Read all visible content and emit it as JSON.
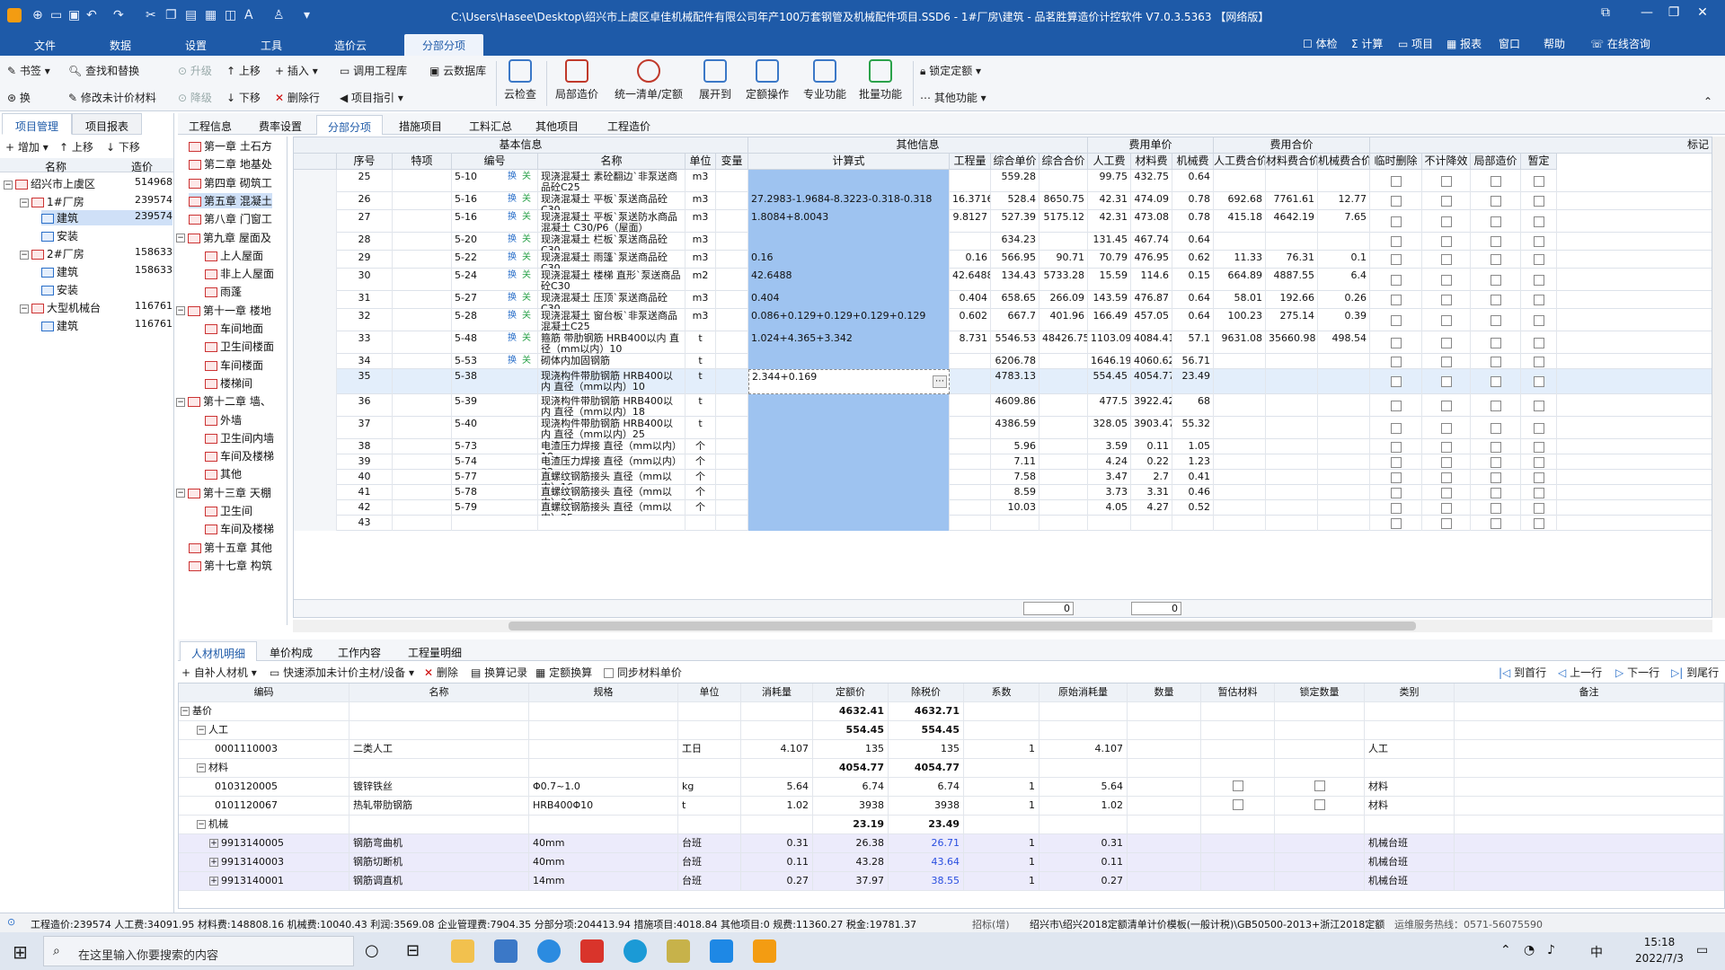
{
  "app": {
    "title": "C:\\Users\\Hasee\\Desktop\\绍兴市上虞区卓佳机械配件有限公司年产100万套钢管及机械配件项目.SSD6 - 1#厂房\\建筑 - 品茗胜算造价计控软件",
    "version": "V7.0.3.5363",
    "network": "【网络版】"
  },
  "menu": {
    "items": [
      "文件",
      "数据",
      "设置",
      "工具",
      "造价云",
      "分部分项"
    ],
    "active": "分部分项",
    "right": [
      "体检",
      "计算",
      "项目",
      "报表",
      "窗口",
      "帮助",
      "在线咨询"
    ]
  },
  "ribbon": {
    "small": [
      "书签",
      "查找和替换",
      "升级",
      "上移",
      "插入",
      "调用工程库",
      "云数据库",
      "换",
      "修改未计价材料",
      "降级",
      "下移",
      "删除行",
      "项目指引",
      "锁定定额",
      "其他功能"
    ],
    "big": [
      "云检查",
      "局部造价",
      "统一清单/定额",
      "展开到",
      "定额操作",
      "专业功能",
      "批量功能"
    ]
  },
  "left": {
    "tabs": [
      "项目管理",
      "项目报表"
    ],
    "toolbar": [
      "增加",
      "上移",
      "下移"
    ],
    "headers": [
      "名称",
      "造价"
    ],
    "tree": [
      {
        "label": "绍兴市上虞区",
        "value": "514968"
      },
      {
        "label": "1#厂房",
        "value": "239574"
      },
      {
        "label": "建筑",
        "value": "239574"
      },
      {
        "label": "安装",
        "value": ""
      },
      {
        "label": "2#厂房",
        "value": "158633"
      },
      {
        "label": "建筑",
        "value": "158633"
      },
      {
        "label": "安装",
        "value": ""
      },
      {
        "label": "大型机械台",
        "value": "116761"
      },
      {
        "label": "建筑",
        "value": "116761"
      }
    ]
  },
  "chapters": [
    "第一章 土石方",
    "第二章 地基处",
    "第四章 砌筑工",
    "第五章 混凝土",
    "第八章 门窗工",
    "第九章 屋面及",
    "上人屋面",
    "非上人屋面",
    "雨蓬",
    "第十一章 楼地",
    "车间地面",
    "卫生间楼面",
    "车间楼面",
    "楼梯间",
    "第十二章 墙、",
    "外墙",
    "卫生间内墙",
    "车间及楼梯",
    "其他",
    "第十三章 天棚",
    "卫生间",
    "车间及楼梯",
    "第十五章 其他",
    "第十七章 构筑"
  ],
  "maintabs": [
    "工程信息",
    "费率设置",
    "分部分项",
    "措施项目",
    "工料汇总",
    "其他项目",
    "工程造价"
  ],
  "grid": {
    "groups": [
      "基本信息",
      "其他信息",
      "费用单价",
      "费用合价",
      "标记"
    ],
    "headers": [
      "序号",
      "特项",
      "编号",
      "名称",
      "单位",
      "变量",
      "计算式",
      "工程量",
      "综合单价",
      "综合合价",
      "人工费",
      "材料费",
      "机械费",
      "人工费合价",
      "材料费合价",
      "机械费合价",
      "临时删除",
      "不计降效",
      "局部造价",
      "暂定"
    ],
    "rows": [
      [
        "25",
        "",
        "5-10",
        "现浇混凝土 素砼翻边`非泵送商品砼C25",
        "m3",
        "",
        "",
        "",
        "559.28",
        "",
        "99.75",
        "432.75",
        "0.64",
        "",
        "",
        ""
      ],
      [
        "26",
        "",
        "5-16",
        "现浇混凝土 平板`泵送商品砼C30",
        "m3",
        "",
        "27.2983-1.9684-8.3223-0.318-0.318",
        "16.3716",
        "528.4",
        "8650.75",
        "42.31",
        "474.09",
        "0.78",
        "692.68",
        "7761.61",
        "12.77"
      ],
      [
        "27",
        "",
        "5-16",
        "现浇混凝土 平板`泵送防水商品混凝土 C30/P6（屋面）",
        "m3",
        "",
        "1.8084+8.0043",
        "9.8127",
        "527.39",
        "5175.12",
        "42.31",
        "473.08",
        "0.78",
        "415.18",
        "4642.19",
        "7.65"
      ],
      [
        "28",
        "",
        "5-20",
        "现浇混凝土 栏板`泵送商品砼C30",
        "m3",
        "",
        "",
        "",
        "634.23",
        "",
        "131.45",
        "467.74",
        "0.64",
        "",
        "",
        ""
      ],
      [
        "29",
        "",
        "5-22",
        "现浇混凝土 雨篷`泵送商品砼C30",
        "m3",
        "",
        "0.16",
        "0.16",
        "566.95",
        "90.71",
        "70.79",
        "476.95",
        "0.62",
        "11.33",
        "76.31",
        "0.1"
      ],
      [
        "30",
        "",
        "5-24",
        "现浇混凝土 楼梯 直形`泵送商品砼C30",
        "m2",
        "",
        "42.6488",
        "42.6488",
        "134.43",
        "5733.28",
        "15.59",
        "114.6",
        "0.15",
        "664.89",
        "4887.55",
        "6.4"
      ],
      [
        "31",
        "",
        "5-27",
        "现浇混凝土 压顶`泵送商品砼C30",
        "m3",
        "",
        "0.404",
        "0.404",
        "658.65",
        "266.09",
        "143.59",
        "476.87",
        "0.64",
        "58.01",
        "192.66",
        "0.26"
      ],
      [
        "32",
        "",
        "5-28",
        "现浇混凝土 窗台板`非泵送商品混凝土C25",
        "m3",
        "",
        "0.086+0.129+0.129+0.129+0.129",
        "0.602",
        "667.7",
        "401.96",
        "166.49",
        "457.05",
        "0.64",
        "100.23",
        "275.14",
        "0.39"
      ],
      [
        "33",
        "",
        "5-48",
        "箍筋 带肋钢筋 HRB400以内 直径（mm以内）10",
        "t",
        "",
        "1.024+4.365+3.342",
        "8.731",
        "5546.53",
        "48426.75",
        "1103.09",
        "4084.41",
        "57.1",
        "9631.08",
        "35660.98",
        "498.54"
      ],
      [
        "34",
        "",
        "5-53",
        "砌体内加固钢筋",
        "t",
        "",
        "",
        "",
        "6206.78",
        "",
        "1646.19",
        "4060.62",
        "56.71",
        "",
        "",
        ""
      ],
      [
        "35",
        "",
        "5-38",
        "现浇构件带肋钢筋 HRB400以内 直径（mm以内）10",
        "t",
        "",
        "2.344+0.169",
        "",
        "4783.13",
        "",
        "554.45",
        "4054.77",
        "23.49",
        "",
        "",
        ""
      ],
      [
        "36",
        "",
        "5-39",
        "现浇构件带肋钢筋 HRB400以内 直径（mm以内）18",
        "t",
        "",
        "",
        "",
        "4609.86",
        "",
        "477.5",
        "3922.42",
        "68",
        "",
        "",
        ""
      ],
      [
        "37",
        "",
        "5-40",
        "现浇构件带肋钢筋 HRB400以内 直径（mm以内）25",
        "t",
        "",
        "",
        "",
        "4386.59",
        "",
        "328.05",
        "3903.47",
        "55.32",
        "",
        "",
        ""
      ],
      [
        "38",
        "",
        "5-73",
        "电渣压力焊接 直径（mm以内）18",
        "个",
        "",
        "",
        "",
        "5.96",
        "",
        "3.59",
        "0.11",
        "1.05",
        "",
        "",
        ""
      ],
      [
        "39",
        "",
        "5-74",
        "电渣压力焊接 直径（mm以内）32",
        "个",
        "",
        "",
        "",
        "7.11",
        "",
        "4.24",
        "0.22",
        "1.23",
        "",
        "",
        ""
      ],
      [
        "40",
        "",
        "5-77",
        "直螺纹钢筋接头 直径（mm以内）16",
        "个",
        "",
        "",
        "",
        "7.58",
        "",
        "3.47",
        "2.7",
        "0.41",
        "",
        "",
        ""
      ],
      [
        "41",
        "",
        "5-78",
        "直螺纹钢筋接头 直径（mm以内）20",
        "个",
        "",
        "",
        "",
        "8.59",
        "",
        "3.73",
        "3.31",
        "0.46",
        "",
        "",
        ""
      ],
      [
        "42",
        "",
        "5-79",
        "直螺纹钢筋接头 直径（mm以内）25",
        "个",
        "",
        "",
        "",
        "10.03",
        "",
        "4.05",
        "4.27",
        "0.52",
        "",
        "",
        ""
      ],
      [
        "43",
        "",
        "",
        "",
        "",
        "",
        "",
        "",
        "",
        "",
        "",
        "",
        "",
        "",
        "",
        ""
      ]
    ],
    "footer": [
      "0",
      "0"
    ]
  },
  "bottomtabs": [
    "人材机明细",
    "单价构成",
    "工作内容",
    "工程量明细"
  ],
  "bottomtool": [
    "自补人材机",
    "快速添加未计价主材/设备",
    "删除",
    "换算记录",
    "定额换算",
    "同步材料单价",
    "到首行",
    "上一行",
    "下一行",
    "到尾行"
  ],
  "bgrid": {
    "headers": [
      "编码",
      "名称",
      "规格",
      "单位",
      "消耗量",
      "定额价",
      "除税价",
      "系数",
      "原始消耗量",
      "数量",
      "暂估材料",
      "锁定数量",
      "类别",
      "备注"
    ],
    "rows": [
      {
        "lvl": 0,
        "code": "基价",
        "name": "",
        "spec": "",
        "unit": "",
        "qty": "",
        "price": "4632.41",
        "net": "4632.71",
        "coef": "",
        "orig": "",
        "cat": "",
        "bold": true
      },
      {
        "lvl": 1,
        "code": "人工",
        "name": "",
        "spec": "",
        "unit": "",
        "qty": "",
        "price": "554.45",
        "net": "554.45",
        "coef": "",
        "orig": "",
        "cat": "",
        "bold": true
      },
      {
        "lvl": 2,
        "code": "0001110003",
        "name": "二类人工",
        "spec": "",
        "unit": "工日",
        "qty": "4.107",
        "price": "135",
        "net": "135",
        "coef": "1",
        "orig": "4.107",
        "cat": "人工"
      },
      {
        "lvl": 1,
        "code": "材料",
        "name": "",
        "spec": "",
        "unit": "",
        "qty": "",
        "price": "4054.77",
        "net": "4054.77",
        "coef": "",
        "orig": "",
        "cat": "",
        "bold": true
      },
      {
        "lvl": 2,
        "code": "0103120005",
        "name": "镀锌铁丝",
        "spec": "Φ0.7~1.0",
        "unit": "kg",
        "qty": "5.64",
        "price": "6.74",
        "net": "6.74",
        "coef": "1",
        "orig": "5.64",
        "cat": "材料",
        "chk": true
      },
      {
        "lvl": 2,
        "code": "0101120067",
        "name": "热轧带肋钢筋",
        "spec": "HRB400Φ10",
        "unit": "t",
        "qty": "1.02",
        "price": "3938",
        "net": "3938",
        "coef": "1",
        "orig": "1.02",
        "cat": "材料",
        "chk": true
      },
      {
        "lvl": 1,
        "code": "机械",
        "name": "",
        "spec": "",
        "unit": "",
        "qty": "",
        "price": "23.19",
        "net": "23.49",
        "coef": "",
        "orig": "",
        "cat": "",
        "bold": true
      },
      {
        "lvl": 3,
        "code": "9913140005",
        "name": "钢筋弯曲机",
        "spec": "40mm",
        "unit": "台班",
        "qty": "0.31",
        "price": "26.38",
        "net": "26.71",
        "coef": "1",
        "orig": "0.31",
        "cat": "机械台班",
        "lav": true
      },
      {
        "lvl": 3,
        "code": "9913140003",
        "name": "钢筋切断机",
        "spec": "40mm",
        "unit": "台班",
        "qty": "0.11",
        "price": "43.28",
        "net": "43.64",
        "coef": "1",
        "orig": "0.11",
        "cat": "机械台班",
        "lav": true
      },
      {
        "lvl": 3,
        "code": "9913140001",
        "name": "钢筋调直机",
        "spec": "14mm",
        "unit": "台班",
        "qty": "0.27",
        "price": "37.97",
        "net": "38.55",
        "coef": "1",
        "orig": "0.27",
        "cat": "机械台班",
        "lav": true
      }
    ]
  },
  "status": {
    "text": "工程造价:239574 人工费:34091.95 材料费:148808.16 机械费:10040.43 利润:3569.08 企业管理费:7904.35 分部分项:204413.94 措施项目:4018.84 其他项目:0 规费:11360.27 税金:19781.37",
    "mode": "招标(增)",
    "template": "绍兴市\\绍兴2018定额清单计价模板(一般计税)\\GB50500-2013+浙江2018定额",
    "hotline": "运维服务热线：0571-56075590"
  },
  "taskbar": {
    "search": "在这里输入你要搜索的内容",
    "time": "15:18",
    "date": "2022/7/3",
    "ime": "中"
  }
}
